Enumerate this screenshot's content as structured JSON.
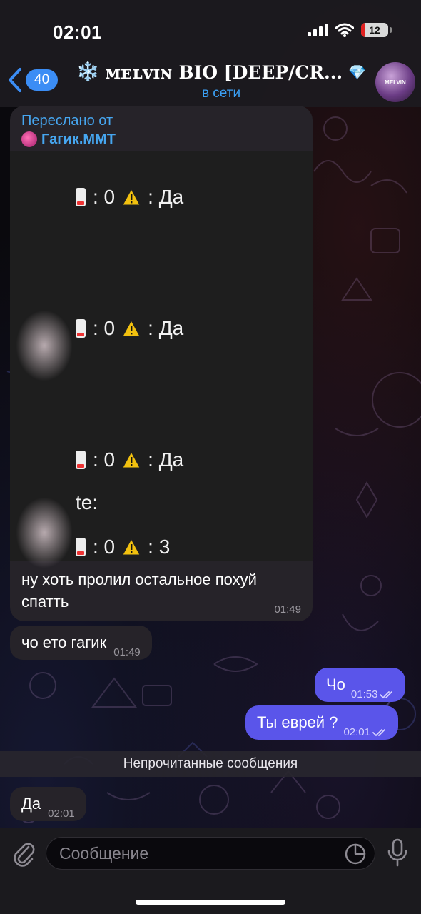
{
  "status_bar": {
    "time": "02:01",
    "battery": "12"
  },
  "header": {
    "back_count": "40",
    "title": "ᴍᴇʟᴠɪɴ BIO [DEEP/CR...",
    "title_icon_left": "❄️",
    "title_icon_right": "💎",
    "status": "в сети",
    "avatar_label": "MELVIN",
    "accent_color": "#3ba0f5"
  },
  "forwarded": {
    "label": "Переслано от",
    "from": "Гагик.MMT",
    "image_rows": [
      {
        "count": ": 0",
        "value": ": Да"
      },
      {
        "count": ": 0",
        "value": ": Да"
      },
      {
        "count": ": 0",
        "value": ": Да"
      },
      {
        "count": ": 0",
        "value": ": 3"
      }
    ],
    "image_fragment": "te:",
    "text": "ну хоть пролил остальное похуй спатть",
    "time": "01:49"
  },
  "messages": [
    {
      "text": "чо ето гагик",
      "time": "01:49",
      "outgoing": false
    },
    {
      "text": "Чо",
      "time": "01:53",
      "outgoing": true,
      "read": true
    },
    {
      "text": "Ты еврей ?",
      "time": "02:01",
      "outgoing": true,
      "read": true
    },
    {
      "text": "Да",
      "time": "02:01",
      "outgoing": false
    }
  ],
  "unread_notice": "Непрочитанные сообщения",
  "input": {
    "placeholder": "Сообщение"
  },
  "colors": {
    "outgoing_bubble": "#5a55ea",
    "incoming_bubble": "#262329"
  }
}
